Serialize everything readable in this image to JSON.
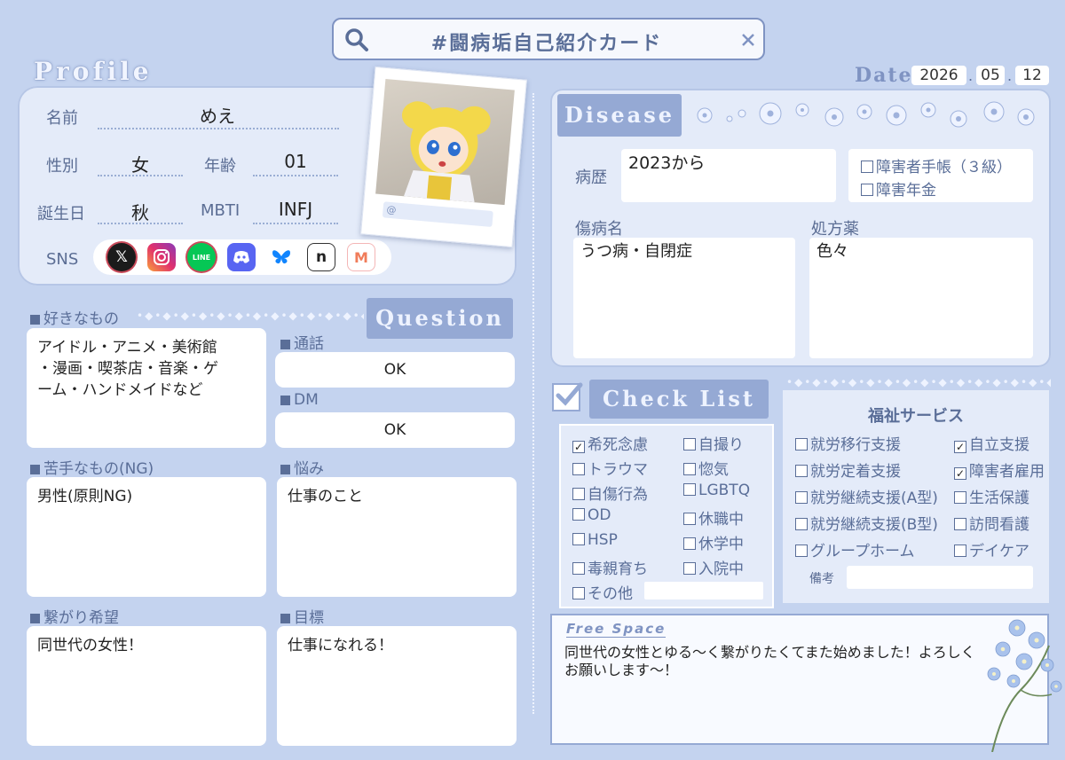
{
  "search": {
    "title": "#闘病垢自己紹介カード"
  },
  "date": {
    "label": "Date",
    "year": "2026",
    "month": "05",
    "day": "12",
    "sep": "."
  },
  "profile": {
    "heading": "Profile",
    "name_label": "名前",
    "name": "めえ",
    "gender_label": "性別",
    "gender": "女",
    "age_label": "年齢",
    "age": "01",
    "birthday_label": "誕生日",
    "birthday": "秋",
    "mbti_label": "MBTI",
    "mbti": "INFJ",
    "sns_label": "SNS",
    "photo_caption": "@"
  },
  "question": {
    "heading": "Question"
  },
  "likes": {
    "label": "好きなもの",
    "text": "アイドル・アニメ・美術館\n・漫画・喫茶店・音楽・ゲ\nーム・ハンドメイドなど"
  },
  "call": {
    "label": "通話",
    "value": "OK"
  },
  "dm": {
    "label": "DM",
    "value": "OK"
  },
  "dislikes": {
    "label": "苦手なもの(NG)",
    "text": "男性(原則NG)"
  },
  "worries": {
    "label": "悩み",
    "text": "仕事のこと"
  },
  "connect": {
    "label": "繋がり希望",
    "text": "同世代の女性！"
  },
  "goal": {
    "label": "目標",
    "text": "仕事になれる！"
  },
  "disease": {
    "heading": "Disease",
    "history_label": "病歴",
    "history": "2023から",
    "notebook": "障害者手帳（３級）",
    "pension": "障害年金",
    "diagnosis_label": "傷病名",
    "diagnosis": "うつ病・自閉症",
    "meds_label": "処方薬",
    "meds": "色々"
  },
  "checklist": {
    "heading": "Check List",
    "col1": [
      {
        "label": "希死念慮",
        "checked": true
      },
      {
        "label": "トラウマ",
        "checked": false
      },
      {
        "label": "自傷行為",
        "checked": false
      },
      {
        "label": "OD",
        "checked": false
      },
      {
        "label": "HSP",
        "checked": false
      },
      {
        "label": "毒親育ち",
        "checked": false
      },
      {
        "label": "その他",
        "checked": false
      }
    ],
    "col2": [
      {
        "label": "自撮り",
        "checked": false
      },
      {
        "label": "惚気",
        "checked": false
      },
      {
        "label": "LGBTQ",
        "checked": false
      },
      {
        "label": "休職中",
        "checked": false
      },
      {
        "label": "休学中",
        "checked": false
      },
      {
        "label": "入院中",
        "checked": false
      }
    ]
  },
  "welfare": {
    "title": "福祉サービス",
    "col1": [
      {
        "label": "就労移行支援",
        "checked": false
      },
      {
        "label": "就労定着支援",
        "checked": false
      },
      {
        "label": "就労継続支援(A型)",
        "checked": false
      },
      {
        "label": "就労継続支援(B型)",
        "checked": false
      },
      {
        "label": "グループホーム",
        "checked": false
      }
    ],
    "col2": [
      {
        "label": "自立支援",
        "checked": true
      },
      {
        "label": "障害者雇用",
        "checked": true
      },
      {
        "label": "生活保護",
        "checked": false
      },
      {
        "label": "訪問看護",
        "checked": false
      },
      {
        "label": "デイケア",
        "checked": false
      }
    ],
    "notes_label": "備考"
  },
  "freespace": {
    "label": "Free Space",
    "text": "同世代の女性とゆる〜く繋がりたくてまた始めました！よろしく\nお願いします〜！"
  },
  "icons": [
    "search-icon",
    "close-icon",
    "x-icon",
    "instagram-icon",
    "line-icon",
    "discord-icon",
    "bluesky-icon",
    "note-icon",
    "misskey-icon",
    "checkmark-icon",
    "flower-icon"
  ],
  "colors": {
    "background": "#c4d3ef",
    "panel": "#e4ebf9",
    "heading": "#95a9d4",
    "label": "#5a6e98"
  }
}
